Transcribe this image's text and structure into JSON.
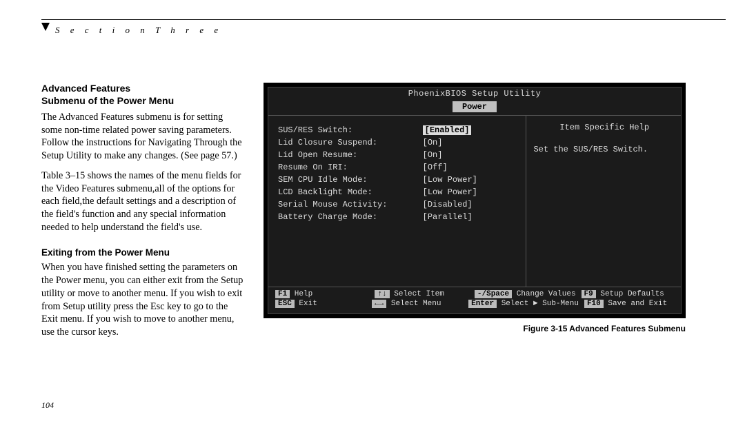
{
  "header": {
    "section_label": "S e c t i o n   T h r e e"
  },
  "left": {
    "h1a": "Advanced Features",
    "h1b": "Submenu of the Power Menu",
    "p1": "The Advanced Features submenu is for setting some non-time related power saving parame­ters. Follow the instructions for Navigating Through the Setup Utility to make any changes. (See page 57.)",
    "p2": "Table 3–15 shows the names of the menu fields for the Video Features submenu,all of the options for each field,the default settings and a description of the field's function and any special information needed to help understand the field's use.",
    "h2": "Exiting from the Power Menu",
    "p3": "When you have finished setting the parameters on the Power menu, you can either exit from the Setup utility or move to another menu. If you wish to exit from Setup utility press the Esc key to go to the Exit menu. If you wish to move to another menu, use the cursor keys."
  },
  "fig_caption": "Figure 3-15 Advanced Features Submenu",
  "bios": {
    "title": "PhoenixBIOS Setup Utility",
    "tab": "Power",
    "rows": [
      {
        "label": "SUS/RES Switch:",
        "value": "[Enabled]",
        "selected": true
      },
      {
        "label": "Lid Closure Suspend:",
        "value": "[On]"
      },
      {
        "label": "Lid Open Resume:",
        "value": "[On]"
      },
      {
        "label": "Resume On IRI:",
        "value": "[Off]"
      },
      {
        "label": "SEM CPU Idle Mode:",
        "value": "[Low Power]"
      },
      {
        "label": "LCD Backlight Mode:",
        "value": "[Low Power]"
      },
      {
        "label": "Serial Mouse Activity:",
        "value": "[Disabled]"
      },
      {
        "label": "Battery Charge Mode:",
        "value": "[Parallel]"
      }
    ],
    "help_title": "Item Specific Help",
    "help_text": "Set the SUS/RES Switch.",
    "foot": {
      "r1": [
        {
          "key": "F1",
          "txt": "Help"
        },
        {
          "key": "↑↓",
          "txt": "Select Item"
        },
        {
          "key": "-/Space",
          "txt": "Change Values"
        },
        {
          "key": "F9",
          "txt": "Setup Defaults"
        }
      ],
      "r2": [
        {
          "key": "ESC",
          "txt": "Exit"
        },
        {
          "key": "←→",
          "txt": "Select Menu"
        },
        {
          "key": "Enter",
          "txt": "Select ► Sub-Menu"
        },
        {
          "key": "F10",
          "txt": "Save and Exit"
        }
      ]
    }
  },
  "page_num": "104"
}
